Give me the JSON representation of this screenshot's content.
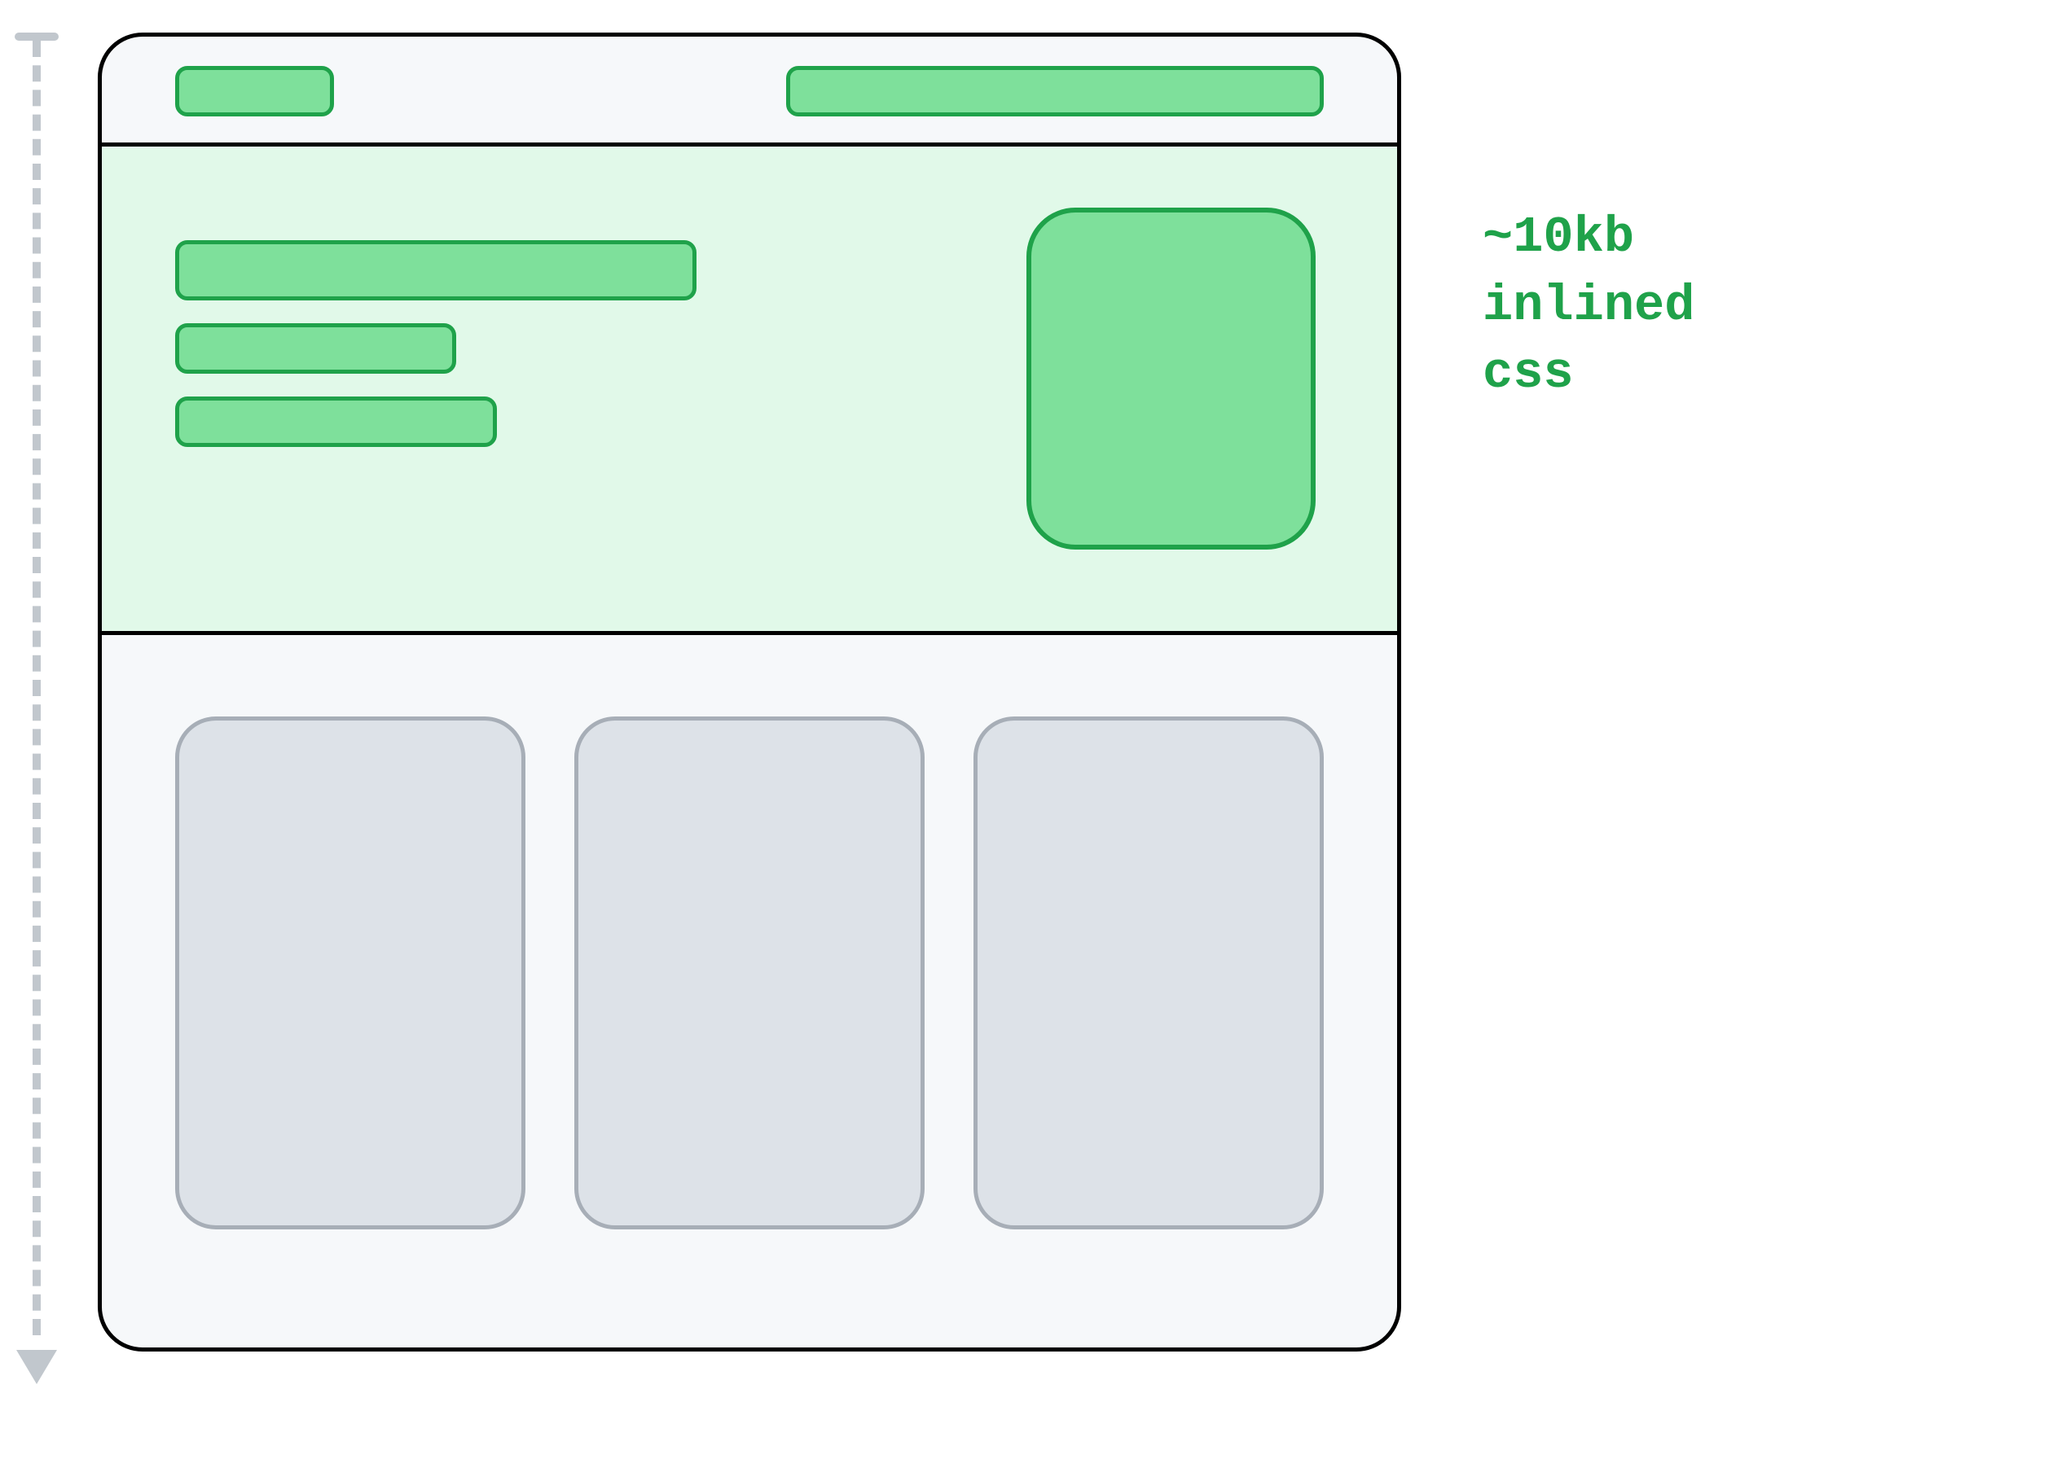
{
  "annotation": {
    "line1": "~10kb",
    "line2": "inlined",
    "line3": "css"
  },
  "colors": {
    "green_fill": "#7ee09b",
    "green_stroke": "#1fa24a",
    "green_light_bg": "#e1f9e9",
    "gray_fill": "#dde2e8",
    "gray_stroke": "#a7aeb7",
    "page_bg": "#f6f8fa",
    "arrow_gray": "#c1c7cd"
  }
}
